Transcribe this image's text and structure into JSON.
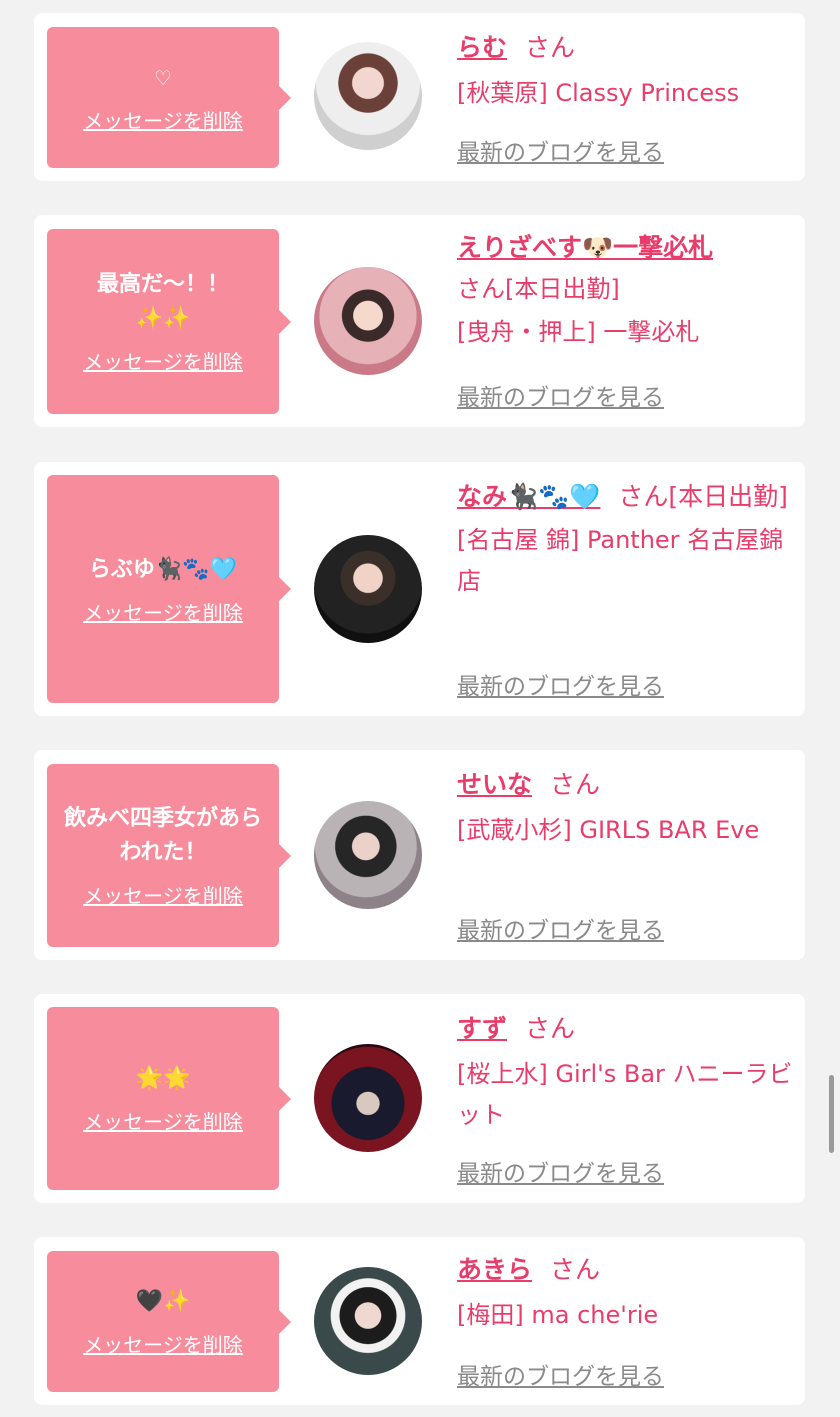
{
  "delete_label": "メッセージを削除",
  "blog_label": "最新のブログを見る",
  "san_label": "さん",
  "colors": {
    "bubble": "#f78d9c",
    "accent": "#e83d6b",
    "card": "#ffffff",
    "background": "#f2f2f2",
    "link_gray": "#8a8a8a"
  },
  "items": [
    {
      "message": "♡",
      "name": "らむ",
      "san": "さん",
      "shop": "[秋葉原] Classy Princess"
    },
    {
      "message": "最高だ〜！！\n✨✨",
      "name": "えりざべす🐶一撃必札",
      "san": "さん[本日出勤]",
      "shop": "[曳舟・押上] 一撃必札"
    },
    {
      "message": "らぶゆ🐈‍⬛🐾🩵",
      "name": "なみ🐈‍⬛🐾🩵",
      "san": "さん[本日出勤]",
      "shop": "[名古屋 錦] Panther 名古屋錦店"
    },
    {
      "message": "飲みべ四季女があらわれた！",
      "name": "せいな",
      "san": "さん",
      "shop": "[武蔵小杉] GIRLS BAR Eve"
    },
    {
      "message": "🌟🌟",
      "name": "すず",
      "san": "さん",
      "shop": "[桜上水] Girl's Bar ハニーラビット"
    },
    {
      "message": "🖤✨",
      "name": "あきら",
      "san": "さん",
      "shop": "[梅田] ma che'rie"
    }
  ]
}
